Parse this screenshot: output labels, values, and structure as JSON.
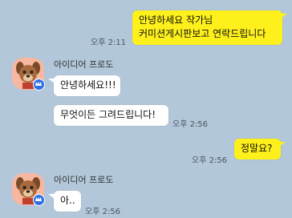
{
  "colors": {
    "background": "#b2c7d9",
    "my_bubble": "#fef01b",
    "their_bubble": "#ffffff",
    "avatar_bg": "#f8b7a0",
    "crown_badge": "#2f6fe6"
  },
  "messages": [
    {
      "side": "mine",
      "lines": [
        "안녕하세요 작가님",
        "커미션게시판보고 연락드립니다"
      ],
      "time": "오후 2:11"
    },
    {
      "side": "theirs",
      "sender": "아이디어 프로도",
      "avatar_icon": "dog-character-avatar-icon",
      "badge_icon": "crown-badge-icon",
      "bubbles": [
        "안녕하세요!!!",
        "무엇이든 그려드립니다!"
      ],
      "time": "오후 2:56"
    },
    {
      "side": "mine",
      "lines": [
        "정말요?"
      ],
      "time": "오후 2:56"
    },
    {
      "side": "theirs",
      "sender": "아이디어 프로도",
      "avatar_icon": "dog-character-avatar-icon",
      "badge_icon": "crown-badge-icon",
      "bubbles": [
        "아.."
      ],
      "time": "오후 2:56"
    }
  ]
}
